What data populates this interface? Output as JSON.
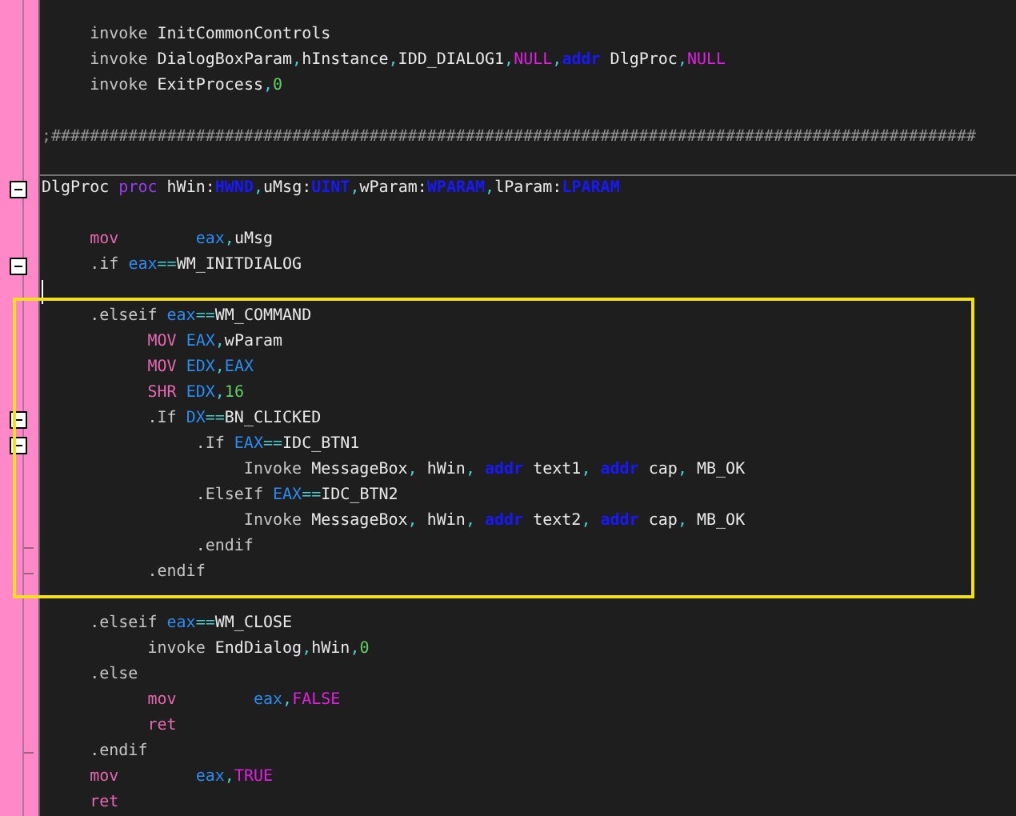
{
  "editor": {
    "blocks": [
      {
        "highlighted": false,
        "lines": [
          {
            "tokens": [
              {
                "text": "     invoke",
                "kind": "invoke"
              },
              {
                "text": " InitCommonControls",
                "kind": "plain"
              }
            ]
          },
          {
            "tokens": [
              {
                "text": "     invoke",
                "kind": "invoke"
              },
              {
                "text": " DialogBoxParam",
                "kind": "plain"
              },
              {
                "text": ",",
                "kind": "punct"
              },
              {
                "text": "hInstance",
                "kind": "plain"
              },
              {
                "text": ",",
                "kind": "punct"
              },
              {
                "text": "IDD_DIALOG1",
                "kind": "plain"
              },
              {
                "text": ",",
                "kind": "punct"
              },
              {
                "text": "NULL",
                "kind": "const"
              },
              {
                "text": ",",
                "kind": "punct"
              },
              {
                "text": "addr",
                "kind": "addr"
              },
              {
                "text": " DlgProc",
                "kind": "plain"
              },
              {
                "text": ",",
                "kind": "punct"
              },
              {
                "text": "NULL",
                "kind": "const"
              }
            ]
          },
          {
            "tokens": [
              {
                "text": "     invoke",
                "kind": "invoke"
              },
              {
                "text": " ExitProcess",
                "kind": "plain"
              },
              {
                "text": ",",
                "kind": "punct"
              },
              {
                "text": "0",
                "kind": "num"
              }
            ]
          },
          {
            "blank_before": true,
            "tokens": [
              {
                "text": ";################################################################################################",
                "kind": "comment"
              }
            ]
          },
          {
            "separator": true
          },
          {
            "fold_start": true,
            "tokens": [
              {
                "text": "DlgProc ",
                "kind": "plain"
              },
              {
                "text": "proc",
                "kind": "proc"
              },
              {
                "text": " hWin:",
                "kind": "plain"
              },
              {
                "text": "HWND",
                "kind": "type"
              },
              {
                "text": ",",
                "kind": "punct"
              },
              {
                "text": "uMsg:",
                "kind": "plain"
              },
              {
                "text": "UINT",
                "kind": "type"
              },
              {
                "text": ",",
                "kind": "punct"
              },
              {
                "text": "wParam:",
                "kind": "plain"
              },
              {
                "text": "WPARAM",
                "kind": "type"
              },
              {
                "text": ",",
                "kind": "punct"
              },
              {
                "text": "lParam:",
                "kind": "plain"
              },
              {
                "text": "LPARAM",
                "kind": "type"
              }
            ]
          },
          {
            "blank_before": true,
            "tokens": [
              {
                "text": "     mov",
                "kind": "instr"
              },
              {
                "text": "        eax",
                "kind": "reg"
              },
              {
                "text": ",",
                "kind": "punct"
              },
              {
                "text": "uMsg",
                "kind": "plain"
              }
            ]
          },
          {
            "fold_start": true,
            "tokens": [
              {
                "text": "     .if",
                "kind": "invoke"
              },
              {
                "text": " eax",
                "kind": "reg"
              },
              {
                "text": "==",
                "kind": "punct"
              },
              {
                "text": "WM_INITDIALOG",
                "kind": "plain"
              }
            ]
          },
          {
            "caret": true
          }
        ]
      },
      {
        "highlighted": true,
        "lines": [
          {
            "tokens": [
              {
                "text": "     .elseif",
                "kind": "invoke"
              },
              {
                "text": " eax",
                "kind": "reg"
              },
              {
                "text": "==",
                "kind": "punct"
              },
              {
                "text": "WM_COMMAND",
                "kind": "plain"
              }
            ]
          },
          {
            "tokens": [
              {
                "text": "           MOV",
                "kind": "instr"
              },
              {
                "text": " EAX",
                "kind": "reg"
              },
              {
                "text": ",",
                "kind": "punct"
              },
              {
                "text": "wParam",
                "kind": "plain"
              }
            ]
          },
          {
            "tokens": [
              {
                "text": "           MOV",
                "kind": "instr"
              },
              {
                "text": " EDX",
                "kind": "reg"
              },
              {
                "text": ",",
                "kind": "punct"
              },
              {
                "text": "EAX",
                "kind": "reg"
              }
            ]
          },
          {
            "tokens": [
              {
                "text": "           SHR",
                "kind": "instr"
              },
              {
                "text": " EDX",
                "kind": "reg"
              },
              {
                "text": ",",
                "kind": "punct"
              },
              {
                "text": "16",
                "kind": "num"
              }
            ]
          },
          {
            "fold_start": true,
            "tokens": [
              {
                "text": "           .If",
                "kind": "invoke"
              },
              {
                "text": " DX",
                "kind": "reg"
              },
              {
                "text": "==",
                "kind": "punct"
              },
              {
                "text": "BN_CLICKED",
                "kind": "plain"
              }
            ]
          },
          {
            "fold_start": true,
            "tokens": [
              {
                "text": "                .If",
                "kind": "invoke"
              },
              {
                "text": " EAX",
                "kind": "reg"
              },
              {
                "text": "==",
                "kind": "punct"
              },
              {
                "text": "IDC_BTN1",
                "kind": "plain"
              }
            ]
          },
          {
            "tokens": [
              {
                "text": "                     Invoke",
                "kind": "invoke"
              },
              {
                "text": " MessageBox",
                "kind": "plain"
              },
              {
                "text": ", ",
                "kind": "punct"
              },
              {
                "text": "hWin",
                "kind": "plain"
              },
              {
                "text": ", ",
                "kind": "punct"
              },
              {
                "text": "addr",
                "kind": "addr"
              },
              {
                "text": " text1",
                "kind": "plain"
              },
              {
                "text": ", ",
                "kind": "punct"
              },
              {
                "text": "addr",
                "kind": "addr"
              },
              {
                "text": " cap",
                "kind": "plain"
              },
              {
                "text": ", ",
                "kind": "punct"
              },
              {
                "text": "MB_OK",
                "kind": "plain"
              }
            ]
          },
          {
            "tokens": [
              {
                "text": "                .ElseIf",
                "kind": "invoke"
              },
              {
                "text": " EAX",
                "kind": "reg"
              },
              {
                "text": "==",
                "kind": "punct"
              },
              {
                "text": "IDC_BTN2",
                "kind": "plain"
              }
            ]
          },
          {
            "tokens": [
              {
                "text": "                     Invoke",
                "kind": "invoke"
              },
              {
                "text": " MessageBox",
                "kind": "plain"
              },
              {
                "text": ", ",
                "kind": "punct"
              },
              {
                "text": "hWin",
                "kind": "plain"
              },
              {
                "text": ", ",
                "kind": "punct"
              },
              {
                "text": "addr",
                "kind": "addr"
              },
              {
                "text": " text2",
                "kind": "plain"
              },
              {
                "text": ", ",
                "kind": "punct"
              },
              {
                "text": "addr",
                "kind": "addr"
              },
              {
                "text": " cap",
                "kind": "plain"
              },
              {
                "text": ", ",
                "kind": "punct"
              },
              {
                "text": "MB_OK",
                "kind": "plain"
              }
            ]
          },
          {
            "fold_end": true,
            "tokens": [
              {
                "text": "                .endif",
                "kind": "invoke"
              }
            ]
          },
          {
            "fold_end": true,
            "tokens": [
              {
                "text": "           .endif",
                "kind": "invoke"
              }
            ]
          }
        ]
      },
      {
        "highlighted": false,
        "lines": [
          {
            "blank_before": true,
            "tokens": [
              {
                "text": "     .elseif",
                "kind": "invoke"
              },
              {
                "text": " eax",
                "kind": "reg"
              },
              {
                "text": "==",
                "kind": "punct"
              },
              {
                "text": "WM_CLOSE",
                "kind": "plain"
              }
            ]
          },
          {
            "tokens": [
              {
                "text": "           invoke",
                "kind": "invoke"
              },
              {
                "text": " EndDialog",
                "kind": "plain"
              },
              {
                "text": ",",
                "kind": "punct"
              },
              {
                "text": "hWin",
                "kind": "plain"
              },
              {
                "text": ",",
                "kind": "punct"
              },
              {
                "text": "0",
                "kind": "num"
              }
            ]
          },
          {
            "tokens": [
              {
                "text": "     .else",
                "kind": "invoke"
              }
            ]
          },
          {
            "tokens": [
              {
                "text": "           mov",
                "kind": "instr"
              },
              {
                "text": "        eax",
                "kind": "reg"
              },
              {
                "text": ",",
                "kind": "punct"
              },
              {
                "text": "FALSE",
                "kind": "const"
              }
            ]
          },
          {
            "tokens": [
              {
                "text": "           ret",
                "kind": "instr"
              }
            ]
          },
          {
            "fold_end": true,
            "tokens": [
              {
                "text": "     .endif",
                "kind": "invoke"
              }
            ]
          },
          {
            "tokens": [
              {
                "text": "     mov",
                "kind": "instr"
              },
              {
                "text": "        eax",
                "kind": "reg"
              },
              {
                "text": ",",
                "kind": "punct"
              },
              {
                "text": "TRUE",
                "kind": "const"
              }
            ]
          },
          {
            "tokens": [
              {
                "text": "     ret",
                "kind": "instr"
              }
            ]
          }
        ]
      }
    ]
  }
}
